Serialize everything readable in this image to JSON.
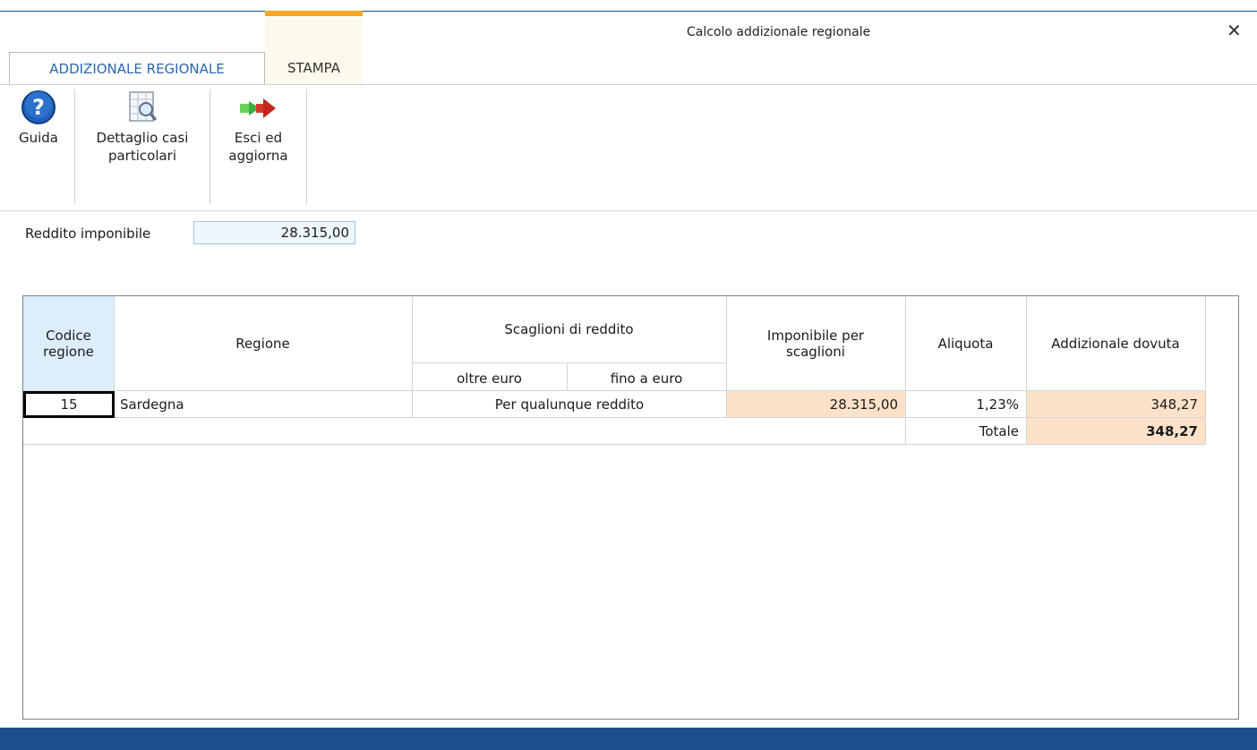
{
  "window": {
    "title": "Calcolo addizionale regionale"
  },
  "tabs": [
    {
      "label": "ADDIZIONALE REGIONALE",
      "active": true
    },
    {
      "label": "STAMPA",
      "active": false
    }
  ],
  "ribbon": {
    "guida": "Guida",
    "dettaglio_line1": "Dettaglio casi",
    "dettaglio_line2": "particolari",
    "esci_line1": "Esci ed",
    "esci_line2": "aggiorna"
  },
  "form": {
    "reddito_label": "Reddito imponibile",
    "reddito_value": "28.315,00"
  },
  "table": {
    "headers": {
      "codice_line1": "Codice",
      "codice_line2": "regione",
      "regione": "Regione",
      "scaglioni": "Scaglioni di reddito",
      "oltre": "oltre euro",
      "fino": "fino a euro",
      "imponibile_line1": "Imponibile per",
      "imponibile_line2": "scaglioni",
      "aliquota": "Aliquota",
      "addizionale": "Addizionale dovuta"
    },
    "row": {
      "codice": "15",
      "regione": "Sardegna",
      "scaglione": "Per qualunque reddito",
      "imponibile": "28.315,00",
      "aliquota": "1,23%",
      "addizionale": "348,27"
    },
    "total_label": "Totale",
    "total_value": "348,27"
  },
  "colors": {
    "accent": "#2b66b0",
    "highlight": "#fde1c8",
    "bottom_bar": "#1f4e8c",
    "stampa_accent": "#f5a623"
  }
}
